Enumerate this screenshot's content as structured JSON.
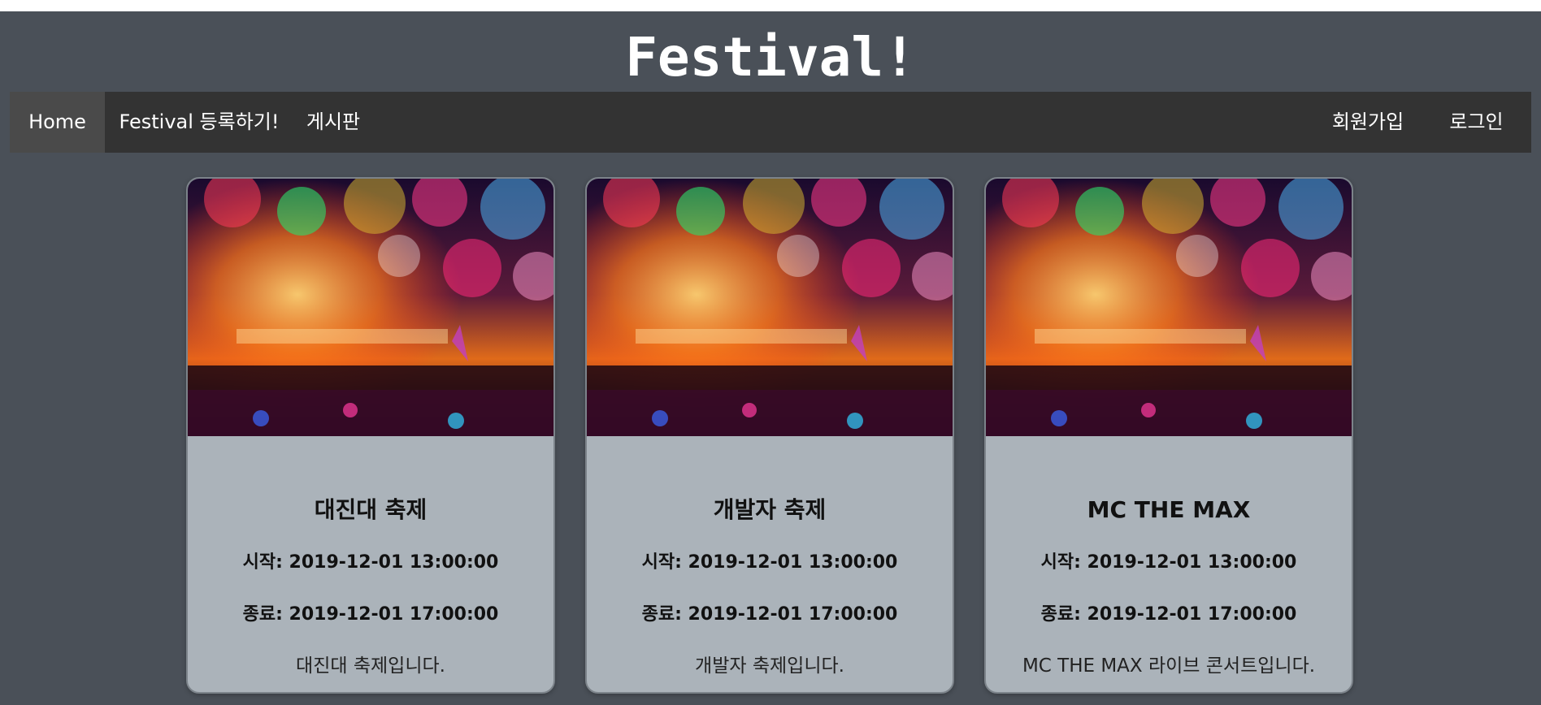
{
  "site": {
    "title": "Festival!"
  },
  "nav": {
    "home": "Home",
    "register_festival": "Festival 등록하기!",
    "board": "게시판",
    "signup": "회원가입",
    "login": "로그인"
  },
  "cards": [
    {
      "title": "대진대 축제",
      "start": "시작: 2019-12-01 13:00:00",
      "end": "종료: 2019-12-01 17:00:00",
      "description": "대진대 축제입니다."
    },
    {
      "title": "개발자 축제",
      "start": "시작: 2019-12-01 13:00:00",
      "end": "종료: 2019-12-01 17:00:00",
      "description": "개발자 축제입니다."
    },
    {
      "title": "MC THE MAX",
      "start": "시작: 2019-12-01 13:00:00",
      "end": "종료: 2019-12-01 17:00:00",
      "description": "MC THE MAX 라이브 콘서트입니다."
    }
  ],
  "colors": {
    "background": "#4a5058",
    "navbar": "#333333",
    "nav_active": "#4a4a4a",
    "card": "#abb3ba"
  }
}
